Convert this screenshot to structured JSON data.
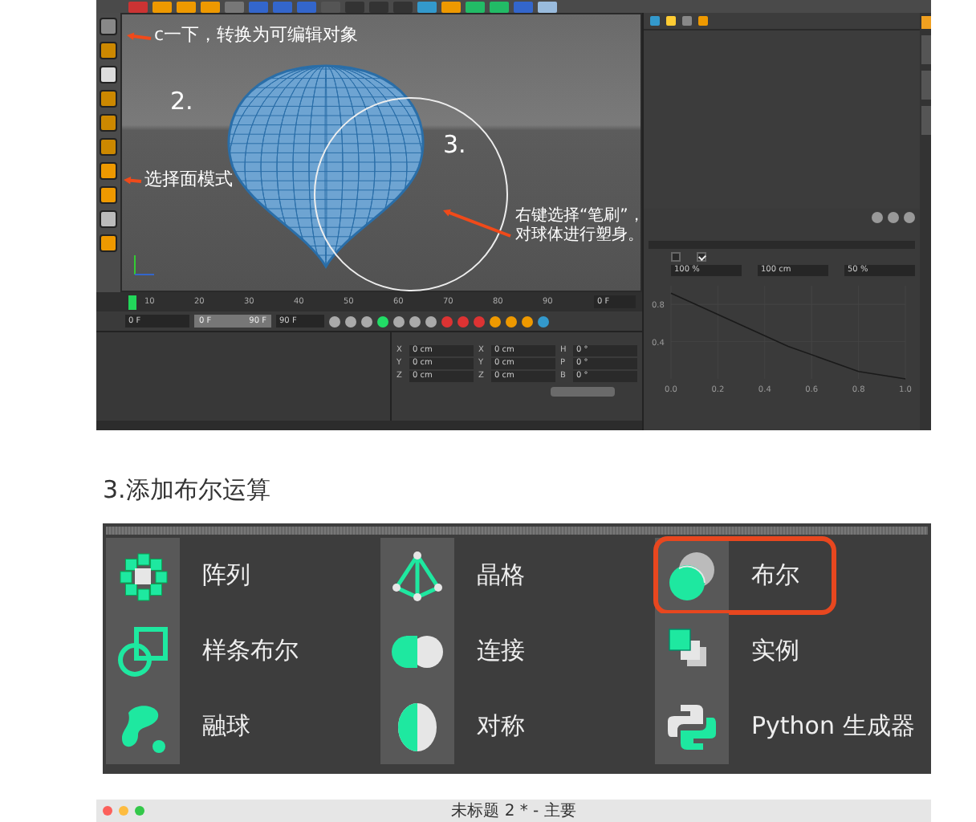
{
  "c4d_screenshot": {
    "viewport": {
      "annotations": [
        {
          "lines": [
            "c一下，转换为可编辑对象"
          ]
        },
        {
          "lines": [
            "2."
          ]
        },
        {
          "lines": [
            "3."
          ]
        },
        {
          "lines": [
            "选择面模式"
          ]
        },
        {
          "lines": [
            "右键选择“笔刷”，",
            "对球体进行塑身。"
          ]
        }
      ]
    },
    "timeline": {
      "ticks": [
        "10",
        "20",
        "30",
        "40",
        "50",
        "60",
        "70",
        "80",
        "90"
      ],
      "frame": "0 F",
      "start": "0 F",
      "range": {
        "level": 1
      },
      "range_start": "0 F",
      "range_end": "90 F",
      "end": "90 F"
    },
    "coordinates": {
      "rows": [
        {
          "pos_axis": "X",
          "pos": "0 cm",
          "size_axis": "X",
          "size": "0 cm",
          "rot_axis": "H",
          "rot": "0 °"
        },
        {
          "pos_axis": "Y",
          "pos": "0 cm",
          "size_axis": "Y",
          "size": "0 cm",
          "rot_axis": "P",
          "rot": "0 °"
        },
        {
          "pos_axis": "Z",
          "pos": "0 cm",
          "size_axis": "Z",
          "size": "0 cm",
          "rot_axis": "B",
          "rot": "0 °"
        }
      ]
    },
    "attributes": {
      "checks": [
        {
          "checked": false
        },
        {
          "checked": true
        }
      ],
      "fields": [
        "100 %",
        "100 cm",
        "50 %"
      ],
      "chart_data": {
        "type": "line",
        "x": [
          0,
          0.5,
          0.8,
          1
        ],
        "series": [
          {
            "color": "#1a1a1a",
            "values": [
              0.92,
              0.35,
              0.08,
              0
            ]
          }
        ],
        "xlim": [
          0,
          1
        ],
        "ylim": [
          0,
          1
        ],
        "grid": true,
        "xticks": [
          {
            "value": 0,
            "label": "0.0"
          },
          {
            "value": 0.2,
            "label": "0.2"
          },
          {
            "value": 0.4,
            "label": "0.4"
          },
          {
            "value": 0.6,
            "label": "0.6"
          },
          {
            "value": 0.8,
            "label": "0.8"
          },
          {
            "value": 1,
            "label": "1.0"
          }
        ],
        "yticks": [
          {
            "value": 0.4,
            "label": "0.4"
          },
          {
            "value": 0.8,
            "label": "0.8"
          }
        ]
      }
    }
  },
  "side_tabs": [
    {
      "selected": true
    },
    {
      "selected": false
    },
    {
      "selected": false
    },
    {
      "selected": false
    }
  ],
  "heading": "3.添加布尔运算",
  "generators": [
    {
      "label": "阵列",
      "highlighted": false
    },
    {
      "label": "晶格",
      "highlighted": false
    },
    {
      "label": "布尔",
      "highlighted": true
    },
    {
      "label": "样条布尔",
      "highlighted": false
    },
    {
      "label": "连接",
      "highlighted": false
    },
    {
      "label": "实例",
      "highlighted": false
    },
    {
      "label": "融球",
      "highlighted": false
    },
    {
      "label": "对称",
      "highlighted": false
    },
    {
      "label": "Python 生成器",
      "highlighted": false
    }
  ],
  "mac_window": {
    "title": "未标题 2 * - 主要"
  }
}
